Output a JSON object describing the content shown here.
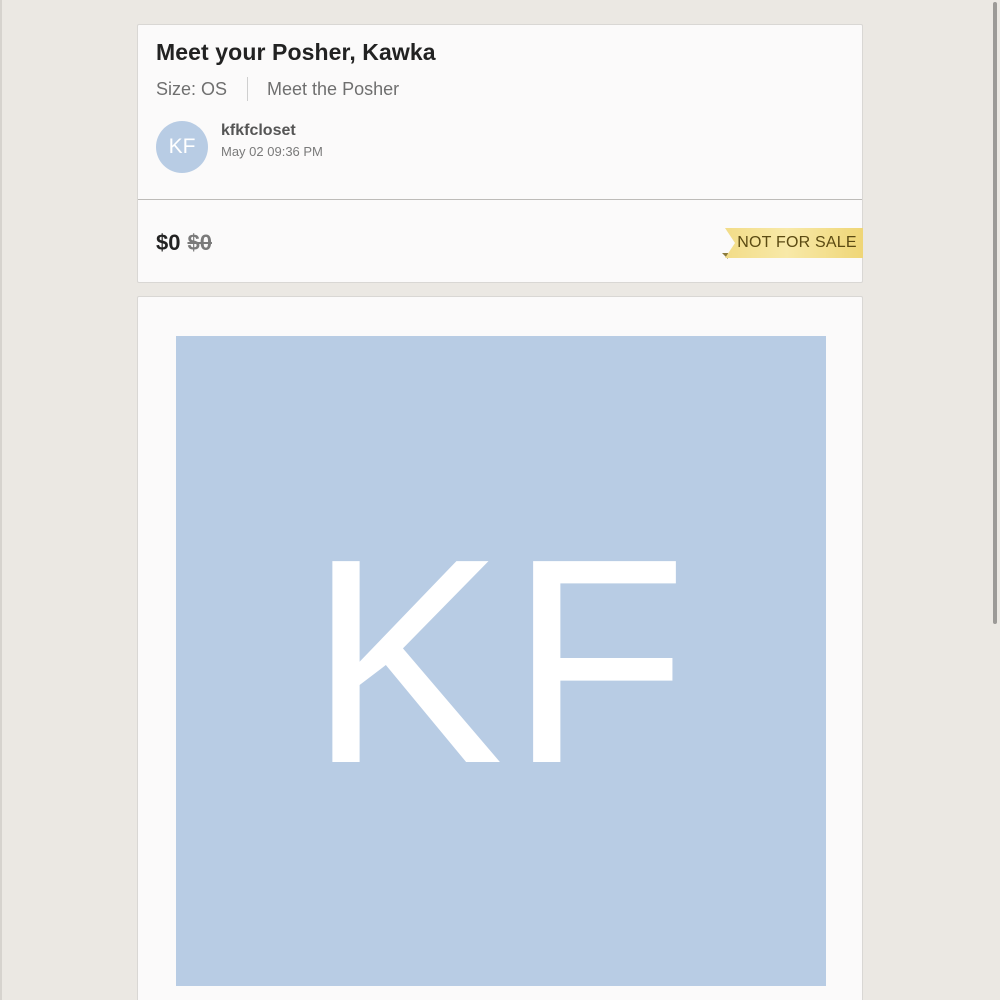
{
  "listing": {
    "title": "Meet your Posher, Kawka",
    "size_label": "Size: OS",
    "category_link": "Meet the Posher",
    "seller": {
      "initials": "KF",
      "username": "kfkfcloset",
      "timestamp": "May 02 09:36 PM"
    },
    "price": "$0",
    "original_price": "$0",
    "status_badge": "NOT FOR SALE"
  },
  "image": {
    "initials": "KF"
  },
  "colors": {
    "background": "#ebe8e3",
    "card": "#fbfafa",
    "avatar": "#b8cce4",
    "badge": "#f5e39a"
  }
}
